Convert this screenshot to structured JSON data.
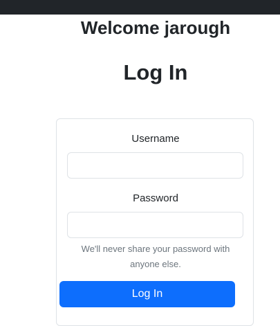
{
  "header": {
    "welcome": "Welcome jarough",
    "title": "Log In"
  },
  "form": {
    "username_label": "Username",
    "username_value": "",
    "password_label": "Password",
    "password_value": "",
    "password_help": "We'll never share your password with anyone else.",
    "submit_label": "Log In"
  },
  "colors": {
    "topbar": "#212529",
    "primary": "#0d6efd",
    "border": "#dee2e6",
    "muted_text": "#6c757d"
  }
}
